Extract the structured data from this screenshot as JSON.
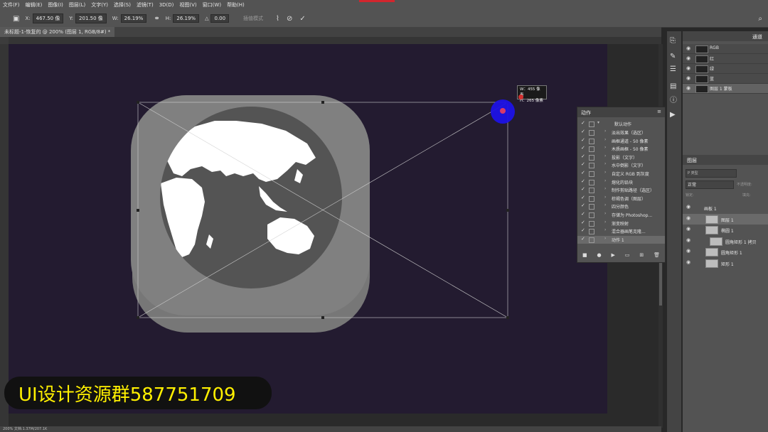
{
  "menu": [
    "文件(F)",
    "编辑(E)",
    "图像(I)",
    "图层(L)",
    "文字(Y)",
    "选择(S)",
    "滤镜(T)",
    "3D(D)",
    "视图(V)",
    "窗口(W)",
    "帮助(H)"
  ],
  "options": {
    "x": "467.50 像",
    "y": "201.50 像",
    "w": "26.19%",
    "h": "26.19%",
    "angle": "0.00",
    "interp": "插值模式"
  },
  "doc_tab": "未标题-1-恢复的 @ 200% (图层 1, RGB/8#) *",
  "channels": [
    {
      "label": "RGB"
    },
    {
      "label": "红"
    },
    {
      "label": "绿"
    },
    {
      "label": "蓝"
    },
    {
      "label": "图层 1 蒙板"
    }
  ],
  "channels_tab": "通道",
  "layers_tab": "图层",
  "blend_mode": "正常",
  "layers_controls": {
    "search": "P 类型",
    "opacity": "不透明度:",
    "lock": "锁定:",
    "fill": "填充:"
  },
  "layers": [
    {
      "label": "画板 1"
    },
    {
      "label": "图层 1"
    },
    {
      "label": "椭圆 1"
    },
    {
      "label": "圆角矩形 1 拷贝"
    },
    {
      "label": "圆角矩形 1"
    },
    {
      "label": "矩形 1"
    }
  ],
  "actions": {
    "title": "动作",
    "set": "默认动作",
    "items": [
      "淡出效果（选区）",
      "画框通道 - 50 像素",
      "木质画框 - 50 像素",
      "投影（文字）",
      "水中倒影（文字）",
      "自定义 RGB 到灰度",
      "熔化的铅块",
      "制作剪贴路径（选区）",
      "棕褐色调（图层）",
      "四分颜色",
      "存储为 Photoshop...",
      "渐变映射",
      "混合器画笔克隆...",
      "动作 1"
    ]
  },
  "tooltip": {
    "w": "W：455 像素",
    "h": "H：265 像素"
  },
  "status": "200%    文档:1.37M/207.1K",
  "watermark": "UI设计资源群587751709",
  "colors": {
    "canvas": "#231b30",
    "icon_bg": "#808080",
    "globe_dark": "#545454",
    "cursor": "#1e12e6"
  }
}
